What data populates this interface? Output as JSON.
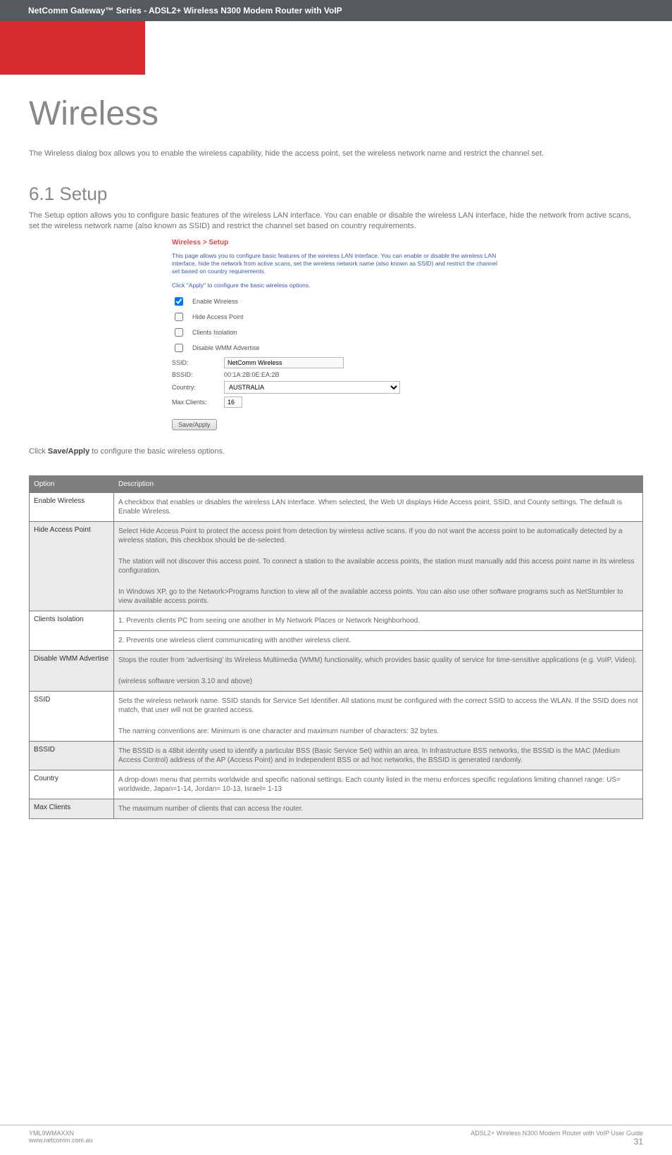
{
  "banner": "NetComm Gateway™ Series - ADSL2+ Wireless N300 Modem Router with VoIP",
  "title": "Wireless",
  "intro": "The Wireless dialog box allows you to enable the wireless capability, hide the access point, set the wireless network name and restrict the channel set.",
  "section_heading": "6.1 Setup",
  "section_intro": "The Setup option allows you to configure basic features of the wireless LAN interface. You can enable or disable the wireless LAN interface, hide the network from active scans, set the wireless network name (also known as SSID) and restrict the channel set based on country requirements.",
  "panel": {
    "breadcrumb": "Wireless > Setup",
    "desc1": "This page allows you to configure basic features of the wireless LAN interface. You can enable or disable the wireless LAN interface, hide the network from active scans, set the wireless network name (also known as SSID) and restrict the channel set based on country requirements.",
    "desc2": "Click \"Apply\" to configure the basic wireless options.",
    "checkboxes": {
      "enable_wireless": "Enable Wireless",
      "hide_ap": "Hide Access Point",
      "clients_isolation": "Clients Isolation",
      "disable_wmm": "Disable WMM Advertise"
    },
    "fields": {
      "ssid_label": "SSID:",
      "ssid_value": "NetComm Wireless",
      "bssid_label": "BSSID:",
      "bssid_value": "00:1A:2B:0E:EA:2B",
      "country_label": "Country:",
      "country_value": "AUSTRALIA",
      "max_clients_label": "Max Clients:",
      "max_clients_value": "16"
    },
    "save_button": "Save/Apply"
  },
  "click_save_prefix": "Click ",
  "click_save_bold": "Save/Apply",
  "click_save_suffix": " to configure the basic wireless options.",
  "table": {
    "header_option": "Option",
    "header_desc": "Description",
    "rows": [
      {
        "k": "Enable Wireless",
        "v": "A checkbox that enables or disables the wireless LAN interface.  When selected, the Web UI displays Hide Access point, SSID, and County settings.  The default is Enable Wireless."
      },
      {
        "k": "Hide Access Point",
        "v": "Select Hide Access Point to protect  the access point from detection by wireless active scans.  If you do not want the access point to be automatically detected by a wireless station, this checkbox should be de-selected.\nThe station will not discover this access point.  To connect a station to the available access points, the station must manually add this access point name in its wireless configuration.\nIn Windows XP, go to the Network>Programs function to view all of the available access points.  You can also use other software programs such as NetStumbler to view available access points."
      },
      {
        "k": "Clients Isolation",
        "v": "1. Prevents clients PC from seeing one another in My Network Places or Network Neighborhood."
      },
      {
        "k": "",
        "v": "2. Prevents one wireless client communicating with another wireless client."
      },
      {
        "k": "Disable WMM Advertise",
        "v": "Stops the router from ‘advertising’ its Wireless Multimedia (WMM) functionality, which provides basic quality of service for time-sensitive applications (e.g. VoIP, Video).\n(wireless software version 3.10 and above)"
      },
      {
        "k": "SSID",
        "v": "Sets the wireless network name.  SSID stands for Service Set Identifier.  All stations must be configured with the correct SSID to access the WLAN.  If the SSID does not match, that user will not be granted access.\nThe naming conventions are: Minimum is one character and maximum number of characters: 32 bytes."
      },
      {
        "k": "BSSID",
        "v": "The BSSID is a 48bit identity used to identify a particular BSS (Basic Service Set) within an area. In Infrastructure BSS networks, the BSSID is the MAC (Medium Access Control) address of the AP (Access Point) and in Independent BSS or ad hoc networks, the BSSID is generated randomly."
      },
      {
        "k": "Country",
        "v": "A drop-down menu that permits worldwide and specific national settings.  Each county listed in the menu enforces specific regulations limiting channel range: US= worldwide, Japan=1-14, Jordan= 10-13, Israel= 1-13"
      },
      {
        "k": "Max Clients",
        "v": "The maximum number of clients that can access the router."
      }
    ]
  },
  "footer": {
    "left1": "YML9WMAXXN",
    "left2": "www.netcomm.com.au",
    "right1": "ADSL2+ Wireless N300 Modem Router with VoIP User Guide",
    "page_no": "31"
  }
}
